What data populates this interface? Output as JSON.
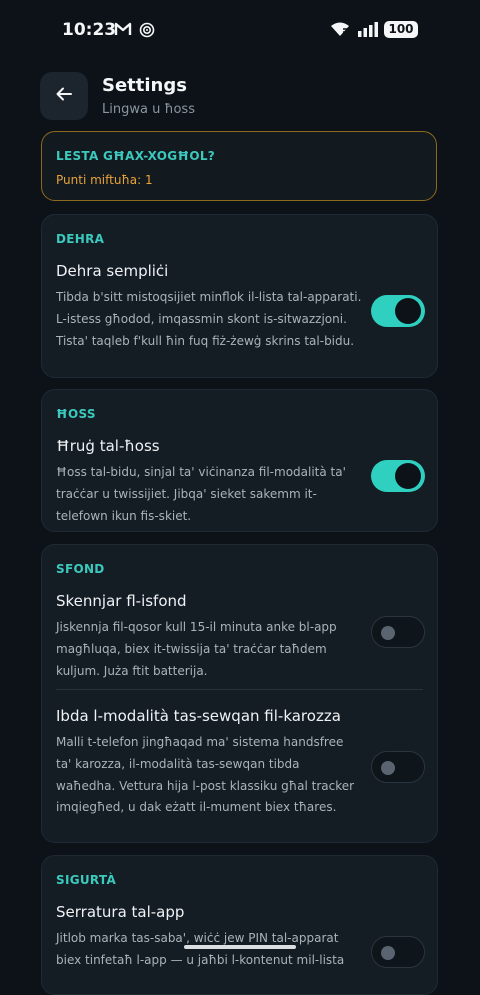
{
  "status_bar": {
    "time": "10:23",
    "battery": "100"
  },
  "header": {
    "title": "Settings",
    "subtitle": "Lingwa u ħoss"
  },
  "banner": {
    "title": "LESTA GĦAX-XOGĦOL?",
    "text": "Punti miftuħa: 1"
  },
  "sections": [
    {
      "label": "DEHRA",
      "items": [
        {
          "title": "Dehra sempliċi",
          "description": "Tibda b'sitt mistoqsijiet minflok il-lista tal-apparati. L-istess għodod, imqassmin skont is-sitwazzjoni. Tista' taqleb f'kull ħin fuq fiż-żewġ skrins tal-bidu.",
          "enabled": true
        }
      ]
    },
    {
      "label": "ĦOSS",
      "items": [
        {
          "title": "Ħruġ tal-ħoss",
          "description": "Ħoss tal-bidu, sinjal ta' viċinanza fil-modalità ta' traċċar u twissijiet. Jibqa' sieket sakemm it-telefown ikun fis-skiet.",
          "enabled": true
        }
      ]
    },
    {
      "label": "SFOND",
      "items": [
        {
          "title": "Skennjar fl-isfond",
          "description": "Jiskennja fil-qosor kull 15-il minuta anke bl-app magħluqa, biex it-twissija ta' traċċar taħdem kuljum. Juża ftit batterija.",
          "enabled": false
        },
        {
          "title": "Ibda l-modalità tas-sewqan fil-karozza",
          "description": "Malli t-telefon jingħaqad ma' sistema handsfree ta' karozza, il-modalità tas-sewqan tibda waħedha. Vettura hija l-post klassiku għal tracker imqiegħed, u dak eżatt il-mument biex tħares.",
          "enabled": false
        }
      ]
    },
    {
      "label": "SIGURTÀ",
      "items": [
        {
          "title": "Serratura tal-app",
          "description": "Jitlob marka tas-saba', wiċċ jew PIN tal-apparat biex tinfetaħ l-app — u jaħbi l-kontenut mil-lista",
          "enabled": false
        }
      ]
    }
  ]
}
